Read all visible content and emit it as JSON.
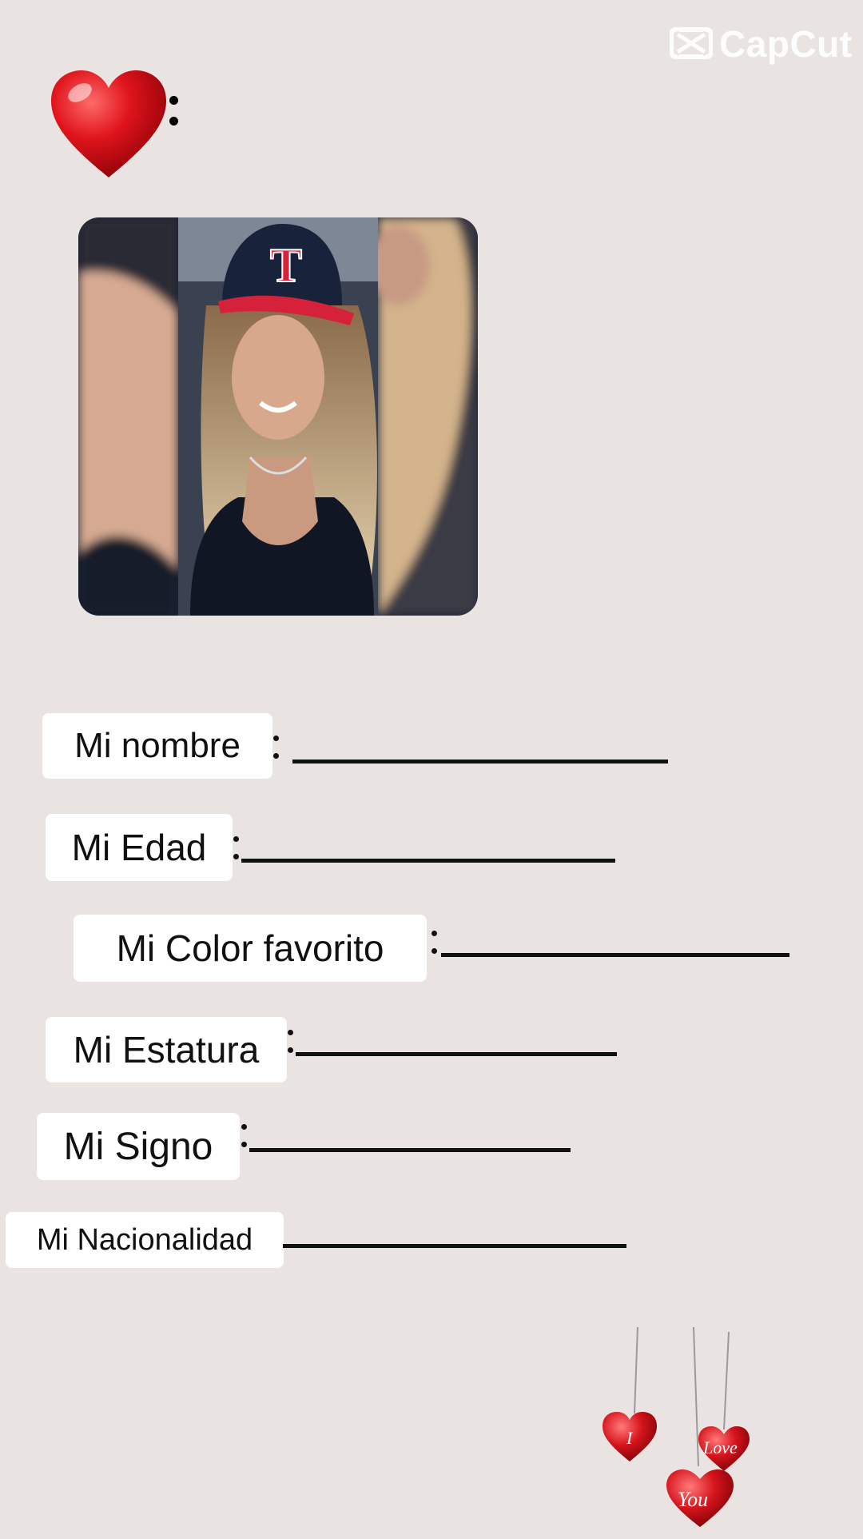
{
  "watermark": {
    "text": "CapCut",
    "icon": "capcut-logo-icon"
  },
  "header": {
    "icon": "red-heart-icon"
  },
  "photo": {
    "description_icon": "profile-photo"
  },
  "fields": [
    {
      "label": "Mi nombre"
    },
    {
      "label": "Mi Edad"
    },
    {
      "label": "Mi Color favorito"
    },
    {
      "label": "Mi Estatura"
    },
    {
      "label": "Mi Signo"
    },
    {
      "label": "Mi Nacionalidad"
    }
  ],
  "decoration": {
    "icon": "hanging-hearts-icon",
    "words": [
      "I",
      "Love",
      "You"
    ]
  },
  "colors": {
    "background": "#e9e4e1",
    "heart": "#d8141c",
    "label_bg": "#ffffff"
  }
}
